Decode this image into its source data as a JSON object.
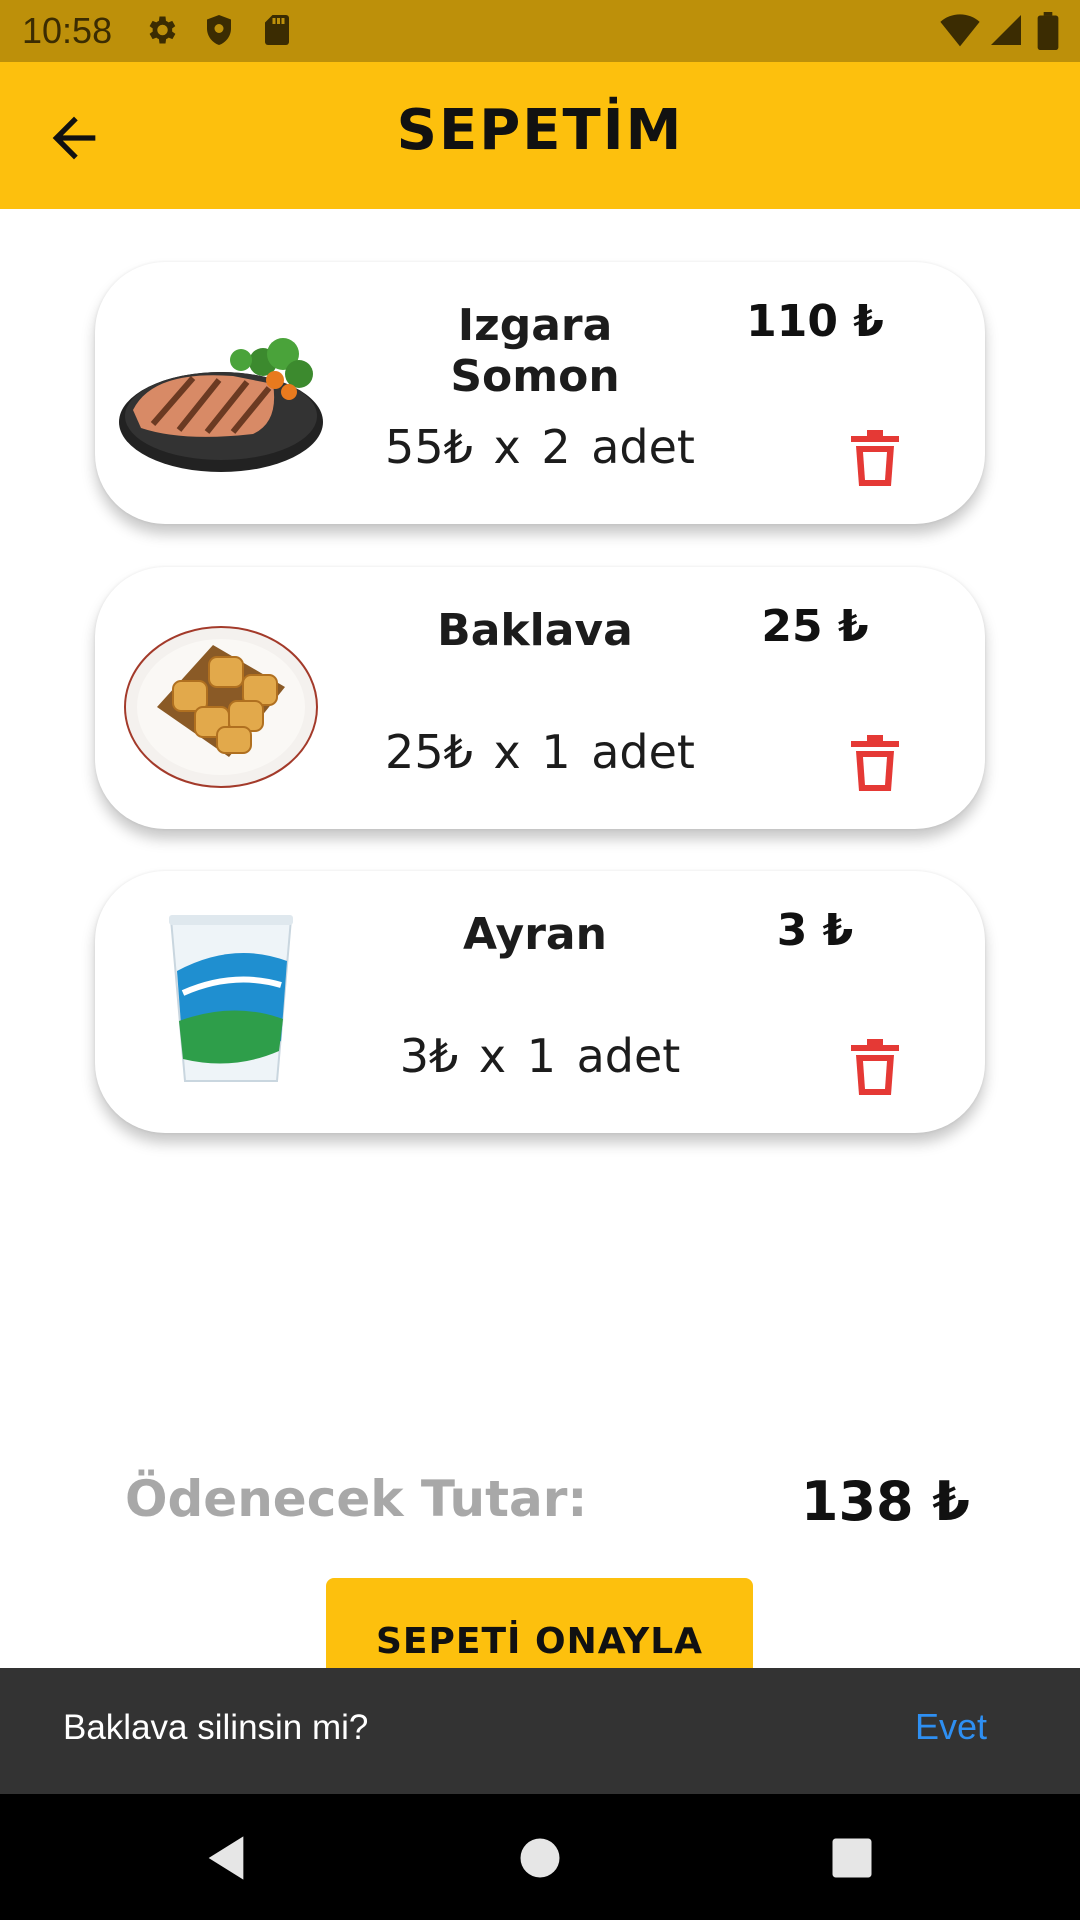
{
  "status_bar": {
    "time": "10:58",
    "left_icons": [
      "settings-icon",
      "shield-icon",
      "sd-card-icon"
    ],
    "right_icons": [
      "wifi-icon",
      "signal-icon",
      "battery-icon"
    ]
  },
  "app_bar": {
    "title": "SEPETİM",
    "back_icon": "arrow-back-icon"
  },
  "cart": {
    "items": [
      {
        "name": "Izgara Somon",
        "price": "110 ₺",
        "quantity": "55₺  x  2 adet",
        "image": "grilled-salmon"
      },
      {
        "name": "Baklava",
        "price": "25 ₺",
        "quantity": "25₺  x  1 adet",
        "image": "baklava"
      },
      {
        "name": "Ayran",
        "price": "3 ₺",
        "quantity": "3₺  x  1 adet",
        "image": "ayran-cup"
      }
    ]
  },
  "summary": {
    "total_label": "Ödenecek Tutar:",
    "total_value": "138 ₺"
  },
  "confirm_button": {
    "label": "SEPETİ ONAYLA"
  },
  "snackbar": {
    "message": "Baklava silinsin mi?",
    "action": "Evet"
  },
  "colors": {
    "accent": "#fdc00d",
    "status_bar": "#bd900a",
    "delete": "#e53935",
    "snackbar_action": "#2e8ff2"
  }
}
